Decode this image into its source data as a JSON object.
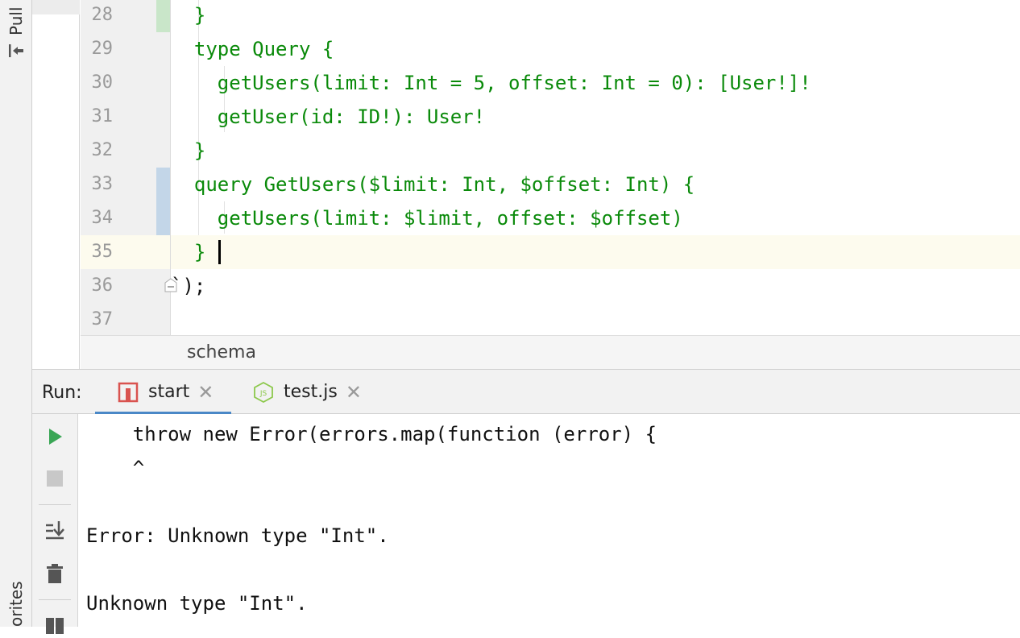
{
  "side_tabs": {
    "pull_requests": "Pull",
    "favorites": "orites"
  },
  "editor": {
    "lines": [
      {
        "number": "28",
        "text": "  }"
      },
      {
        "number": "29",
        "text": "  type Query {"
      },
      {
        "number": "30",
        "text": "    getUsers(limit: Int = 5, offset: Int = 0): [User!]!"
      },
      {
        "number": "31",
        "text": "    getUser(id: ID!): User!"
      },
      {
        "number": "32",
        "text": "  }"
      },
      {
        "number": "33",
        "text": "  query GetUsers($limit: Int, $offset: Int) {"
      },
      {
        "number": "34",
        "text": "    getUsers(limit: $limit, offset: $offset)"
      },
      {
        "number": "35",
        "text": "  }"
      },
      {
        "number": "36",
        "text": "`);"
      },
      {
        "number": "37",
        "text": ""
      }
    ],
    "colors": {
      "code": "#0a8a0a",
      "added_marker": "#c9e6c9",
      "modified_marker": "#c3d6e8",
      "current_line": "#fdfbee"
    }
  },
  "breadcrumb": {
    "item": "schema"
  },
  "run_panel": {
    "label": "Run:",
    "tabs": [
      {
        "label": "start",
        "icon": "npm-icon"
      },
      {
        "label": "test.js",
        "icon": "nodejs-icon"
      }
    ],
    "toolbar": [
      "run-icon",
      "stop-icon",
      "scroll-to-end-icon",
      "trash-icon",
      "layout-icon"
    ]
  },
  "console": {
    "lines": [
      "    throw new Error(errors.map(function (error) {",
      "    ^",
      "",
      "Error: Unknown type \"Int\".",
      "",
      "Unknown type \"Int\"."
    ]
  }
}
